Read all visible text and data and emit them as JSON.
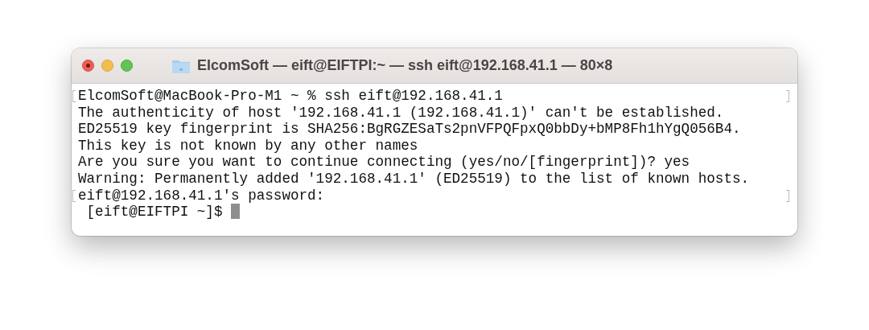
{
  "window": {
    "title": "ElcomSoft — eift@EIFTPI:~ — ssh eift@192.168.41.1 — 80×8"
  },
  "terminal": {
    "lines": [
      {
        "text": "ElcomSoft@MacBook-Pro-M1 ~ % ssh eift@192.168.41.1",
        "marked": true
      },
      {
        "text": "The authenticity of host '192.168.41.1 (192.168.41.1)' can't be established.",
        "marked": false
      },
      {
        "text": "ED25519 key fingerprint is SHA256:BgRGZESaTs2pnVFPQFpxQ0bbDy+bMP8Fh1hYgQ056B4.",
        "marked": false
      },
      {
        "text": "This key is not known by any other names",
        "marked": false
      },
      {
        "text": "Are you sure you want to continue connecting (yes/no/[fingerprint])? yes",
        "marked": false
      },
      {
        "text": "Warning: Permanently added '192.168.41.1' (ED25519) to the list of known hosts.",
        "marked": false
      },
      {
        "text": "eift@192.168.41.1's password:",
        "marked": true
      },
      {
        "text": " [eift@EIFTPI ~]$",
        "marked": false,
        "cursor": true
      }
    ]
  }
}
